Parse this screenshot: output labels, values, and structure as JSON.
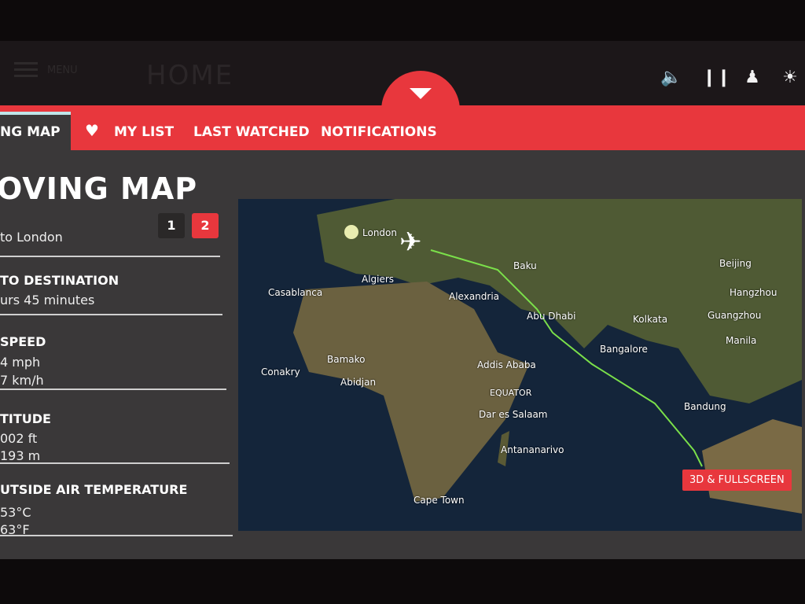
{
  "header": {
    "menu_label": "MENU",
    "title": "HOME",
    "icons": [
      "speaker-icon",
      "fork-knife-icon",
      "person-icon",
      "reading-light-icon"
    ]
  },
  "tabs": [
    {
      "label": "NG MAP",
      "active": true
    },
    {
      "label": "MY LIST",
      "icon": "heart-icon"
    },
    {
      "label": "LAST WATCHED"
    },
    {
      "label": "NOTIFICATIONS"
    }
  ],
  "page_title": "OVING MAP",
  "pager": {
    "pages": [
      "1",
      "2"
    ],
    "active": "2"
  },
  "route": "to London",
  "stats": [
    {
      "label": "TO DESTINATION",
      "values": [
        "urs 45 minutes"
      ]
    },
    {
      "label": "SPEED",
      "values": [
        "4 mph",
        "7 km/h"
      ]
    },
    {
      "label": "TITUDE",
      "values": [
        "002 ft",
        "193 m"
      ]
    },
    {
      "label": "UTSIDE AIR TEMPERATURE",
      "values": [
        "53°C",
        "63°F"
      ]
    }
  ],
  "map": {
    "cities": [
      "London",
      "Baku",
      "Beijing",
      "Algiers",
      "Casablanca",
      "Alexandria",
      "Hangzhou",
      "Abu Dhabi",
      "Kolkata",
      "Guangzhou",
      "Manila",
      "Bangalore",
      "Bamako",
      "Conakry",
      "Abidjan",
      "Addis Ababa",
      "Bandung",
      "Dar es Salaam",
      "Antananarivo",
      "Cape Town"
    ],
    "equator_label": "EQUATOR",
    "route_color": "#7be04a",
    "fullscreen_button": "3D & FULLSCREEN"
  },
  "colors": {
    "accent": "#e8373d",
    "panel": "#3a3839"
  }
}
